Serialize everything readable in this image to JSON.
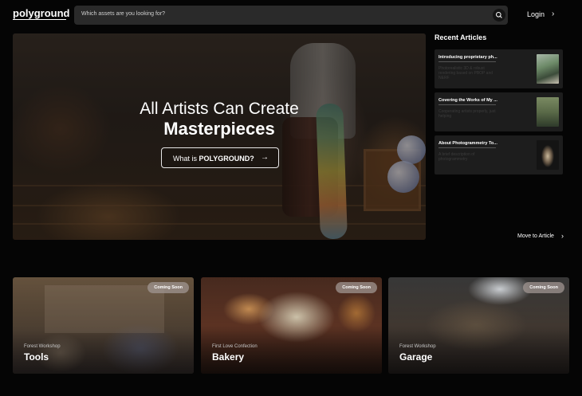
{
  "header": {
    "logo": "polyground",
    "search_placeholder": "Which assets are you looking for?",
    "login_label": "Login",
    "login_arrow": "›"
  },
  "hero": {
    "title_line1": "All Artists Can Create",
    "title_line2": "Masterpieces",
    "button_prefix": "What is ",
    "button_strong": "POLYGROUND?",
    "button_arrow": "→"
  },
  "recent_articles": {
    "heading": "Recent Articles",
    "items": [
      {
        "title": "Introducing proprietary ph...",
        "desc": "Photorealistic 3D & robust rendering based on PBOP and NERF"
      },
      {
        "title": "Covering the Works of My ...",
        "desc": "Cooperating artists properly, just helping"
      },
      {
        "title": "About Photogrammetry To...",
        "desc": "A brief description of photogrammetry"
      }
    ],
    "move_label": "Move to Article",
    "move_arrow": "›"
  },
  "cards": [
    {
      "badge": "Coming Soon",
      "subtitle": "Forest Workshop",
      "name": "Tools"
    },
    {
      "badge": "Coming Soon",
      "subtitle": "First Love Confection",
      "name": "Bakery"
    },
    {
      "badge": "Coming Soon",
      "subtitle": "Forest Workshop",
      "name": "Garage"
    }
  ],
  "colors": {
    "background": "#050505",
    "search_bg": "#2a2a2a",
    "card_bg": "#1d1d1d",
    "badge_bg": "#a09691"
  },
  "icons": [
    "search-icon",
    "chevron-right-icon",
    "arrow-right-icon"
  ]
}
